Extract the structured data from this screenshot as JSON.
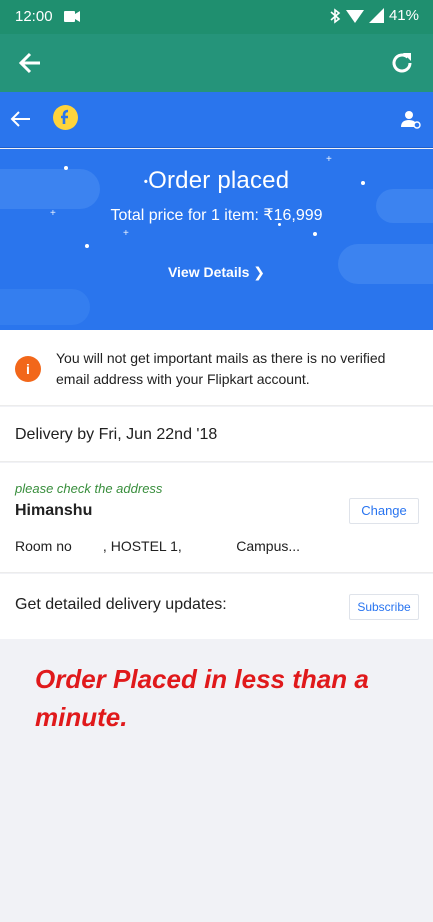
{
  "status_bar": {
    "time": "12:00",
    "battery": "41%"
  },
  "app_toolbar": {
    "back_icon": "arrow-left-icon",
    "refresh_icon": "refresh-icon"
  },
  "fk_header": {
    "back_icon": "arrow-left-icon",
    "logo": "flipkart-logo",
    "account_icon": "account-icon"
  },
  "banner": {
    "title": "Order placed",
    "subtitle": "Total price for 1 item: ₹16,999",
    "view_details": "View Details ❯"
  },
  "notice": {
    "icon_glyph": "i",
    "text": "You will not get important mails as there is no verified email address with your Flipkart account."
  },
  "delivery": {
    "text": "Delivery by Fri, Jun 22nd '18"
  },
  "address": {
    "hint": "please check the address",
    "name": "Himanshu",
    "line": "Room no        , HOSTEL 1,              Campus...",
    "change_label": "Change"
  },
  "updates": {
    "text": "Get detailed delivery updates:",
    "subscribe_label": "Subscribe"
  },
  "annotation": {
    "text": "Order Placed in less than a minute."
  },
  "colors": {
    "status_bar": "#1f8f6f",
    "toolbar": "#25947a",
    "flipkart_blue": "#2a75ed",
    "link_blue": "#2874f0",
    "warning_orange": "#f2671a",
    "hint_green": "#388e3c",
    "annotation_red": "#e0191b"
  }
}
